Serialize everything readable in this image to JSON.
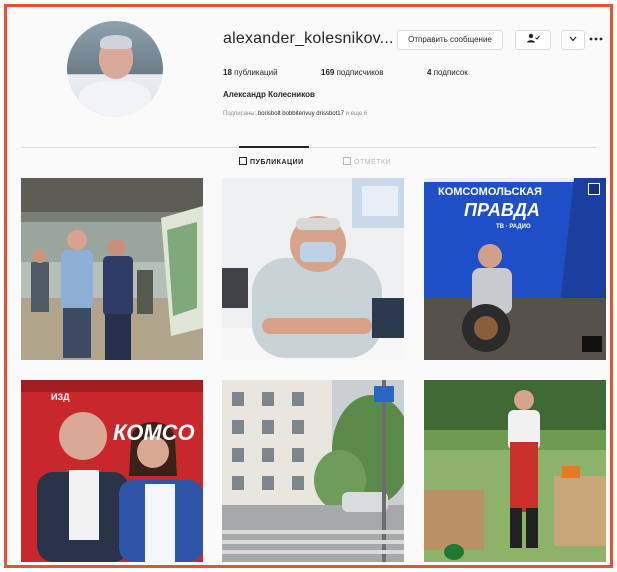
{
  "profile": {
    "username": "alexander_kolesnikov...",
    "full_name": "Александр Колесников",
    "followed_by_prefix": "Подписаны:",
    "followed_by_names": "borisbolt bobbitenvuy drissbot17",
    "followed_by_suffix": "и еще 6"
  },
  "actions": {
    "message_label": "Отправить сообщение",
    "follow_icon": "person-check-icon",
    "more_icon": "chevron-down-icon",
    "options_icon": "more-dots-icon"
  },
  "stats": {
    "posts_count": "18",
    "posts_label": "публикаций",
    "followers_count": "169",
    "followers_label": "подписчиков",
    "following_count": "4",
    "following_label": "подписок"
  },
  "tabs": [
    {
      "label": "ПУБЛИКАЦИИ",
      "icon": "grid-icon",
      "active": true
    },
    {
      "label": "ОТМЕТКИ",
      "icon": "tag-icon",
      "active": false
    }
  ],
  "posts": [
    {
      "alt": "photo"
    },
    {
      "alt": "photo"
    },
    {
      "alt": "photo",
      "banner_line1": "КОМСОМОЛЬСКАЯ",
      "banner_line2": "ПРАВДА",
      "banner_line3": "ТВ · РАДИО"
    },
    {
      "alt": "photo",
      "banner_line1": "ИЗД",
      "banner_line2": "КОМСО"
    },
    {
      "alt": "photo"
    },
    {
      "alt": "photo"
    }
  ],
  "colors": {
    "frame_border": "#e5532f",
    "kp_blue": "#1f4fc7",
    "kp_red": "#c8282c"
  }
}
